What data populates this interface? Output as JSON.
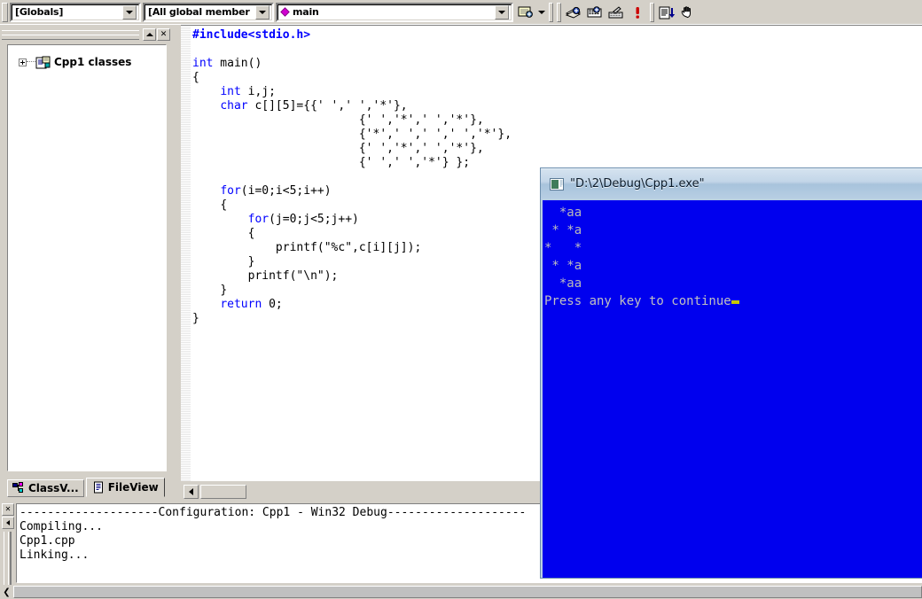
{
  "app": {
    "name": "Microsoft Visual C++",
    "accent_blue": "#0000ff",
    "console_bg": "#0000ee",
    "console_fg": "#c0c0c0",
    "cursor_color": "#c8c800",
    "chrome_gray": "#d4d0c8"
  },
  "toolbar": {
    "scope_combo": {
      "value": "[Globals]",
      "name": "globals-combo"
    },
    "member_combo": {
      "value": "[All global member",
      "name": "all-global-members-combo"
    },
    "function_combo": {
      "value": "main",
      "icon": "magenta-diamond-icon",
      "name": "function-combo"
    },
    "buttons": [
      {
        "label": "Edit Code",
        "icon": "edit-code-icon"
      },
      {
        "label": "Insert/Remove Breakpoint",
        "icon": "breakpoint-icon"
      },
      {
        "label": "Bookmark",
        "icon": "bookmark-icon"
      },
      {
        "label": "Disable Breakpoint",
        "icon": "disable-breakpoint-icon"
      },
      {
        "label": "Errors",
        "icon": "error-exclamation-icon"
      },
      {
        "label": "Go To Next",
        "icon": "list-down-arrow-icon"
      },
      {
        "label": "Pan",
        "icon": "hand-icon"
      }
    ]
  },
  "workspace": {
    "title_buttons": [
      {
        "label": "Minimize",
        "icon": "minimize-icon"
      },
      {
        "label": "Close",
        "icon": "close-icon"
      }
    ],
    "tree": [
      {
        "label": "Cpp1 classes",
        "icon": "class-folder-icon",
        "expanded": false
      }
    ],
    "tabs": [
      {
        "label": "ClassV...",
        "icon": "classview-icon",
        "active": false
      },
      {
        "label": "FileView",
        "icon": "fileview-icon",
        "active": true
      }
    ]
  },
  "editor": {
    "filename": "Cpp1.cpp",
    "code_lines": [
      {
        "indent": 0,
        "segments": [
          {
            "t": "#include<stdio.h>",
            "c": "pp"
          }
        ]
      },
      {
        "indent": 0,
        "segments": [
          {
            "t": "",
            "c": ""
          }
        ]
      },
      {
        "indent": 0,
        "segments": [
          {
            "t": "int",
            "c": "kw"
          },
          {
            "t": " main()",
            "c": ""
          }
        ]
      },
      {
        "indent": 0,
        "segments": [
          {
            "t": "{",
            "c": ""
          }
        ]
      },
      {
        "indent": 1,
        "segments": [
          {
            "t": "int",
            "c": "kw"
          },
          {
            "t": " i,j;",
            "c": ""
          }
        ]
      },
      {
        "indent": 1,
        "segments": [
          {
            "t": "char",
            "c": "kw"
          },
          {
            "t": " c[][5]={{' ',' ','*'},",
            "c": ""
          }
        ]
      },
      {
        "indent": 0,
        "segments": [
          {
            "t": "                        {' ','*',' ','*'},",
            "c": ""
          }
        ]
      },
      {
        "indent": 0,
        "segments": [
          {
            "t": "                        {'*',' ',' ',' ','*'},",
            "c": ""
          }
        ]
      },
      {
        "indent": 0,
        "segments": [
          {
            "t": "                        {' ','*',' ','*'},",
            "c": ""
          }
        ]
      },
      {
        "indent": 0,
        "segments": [
          {
            "t": "                        {' ',' ','*'} };",
            "c": ""
          }
        ]
      },
      {
        "indent": 0,
        "segments": [
          {
            "t": "",
            "c": ""
          }
        ]
      },
      {
        "indent": 1,
        "segments": [
          {
            "t": "for",
            "c": "kw"
          },
          {
            "t": "(i=0;i<5;i++)",
            "c": ""
          }
        ]
      },
      {
        "indent": 1,
        "segments": [
          {
            "t": "{",
            "c": ""
          }
        ]
      },
      {
        "indent": 2,
        "segments": [
          {
            "t": "for",
            "c": "kw"
          },
          {
            "t": "(j=0;j<5;j++)",
            "c": ""
          }
        ]
      },
      {
        "indent": 2,
        "segments": [
          {
            "t": "{",
            "c": ""
          }
        ]
      },
      {
        "indent": 3,
        "segments": [
          {
            "t": "printf(\"%c\",c[i][j]);",
            "c": ""
          }
        ]
      },
      {
        "indent": 2,
        "segments": [
          {
            "t": "}",
            "c": ""
          }
        ]
      },
      {
        "indent": 2,
        "segments": [
          {
            "t": "printf(\"\\n\");",
            "c": ""
          }
        ]
      },
      {
        "indent": 1,
        "segments": [
          {
            "t": "}",
            "c": ""
          }
        ]
      },
      {
        "indent": 1,
        "segments": [
          {
            "t": "return",
            "c": "kw"
          },
          {
            "t": " 0;",
            "c": ""
          }
        ]
      },
      {
        "indent": 0,
        "segments": [
          {
            "t": "}",
            "c": ""
          }
        ]
      }
    ]
  },
  "output": {
    "lines": [
      "--------------------Configuration: Cpp1 - Win32 Debug--------------------",
      "Compiling...",
      "Cpp1.cpp",
      "Linking..."
    ]
  },
  "console": {
    "title": "\"D:\\2\\Debug\\Cpp1.exe\"",
    "icon": "console-window-icon",
    "lines": [
      "  *aa",
      " * *a",
      "*   *",
      " * *a",
      "  *aa"
    ],
    "prompt": "Press any key to continue"
  }
}
